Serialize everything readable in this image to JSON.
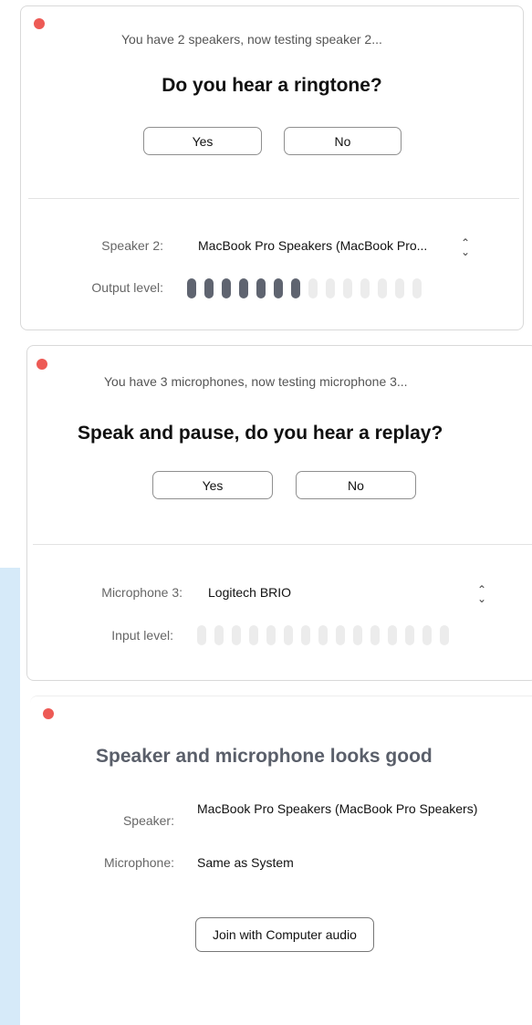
{
  "speaker_test": {
    "status": "You have 2 speakers, now testing speaker 2...",
    "question": "Do you hear a ringtone?",
    "yes_label": "Yes",
    "no_label": "No",
    "device_label": "Speaker 2:",
    "device_value": "MacBook Pro Speakers (MacBook Pro...",
    "level_label": "Output level:",
    "level": {
      "active": 7,
      "total": 14
    }
  },
  "mic_test": {
    "status": "You have 3 microphones, now testing microphone 3...",
    "question": "Speak and pause, do you hear a replay?",
    "yes_label": "Yes",
    "no_label": "No",
    "device_label": "Microphone 3:",
    "device_value": "Logitech BRIO",
    "level_label": "Input level:",
    "level": {
      "active": 0,
      "total": 15
    }
  },
  "summary": {
    "heading": "Speaker and microphone looks good",
    "speaker_label": "Speaker:",
    "speaker_value": "MacBook Pro Speakers (MacBook Pro Speakers)",
    "mic_label": "Microphone:",
    "mic_value": "Same as System",
    "join_label": "Join with Computer audio"
  },
  "colors": {
    "close_dot": "#ed5a55",
    "level_active": "#5f6470",
    "level_inactive": "#ececec"
  }
}
